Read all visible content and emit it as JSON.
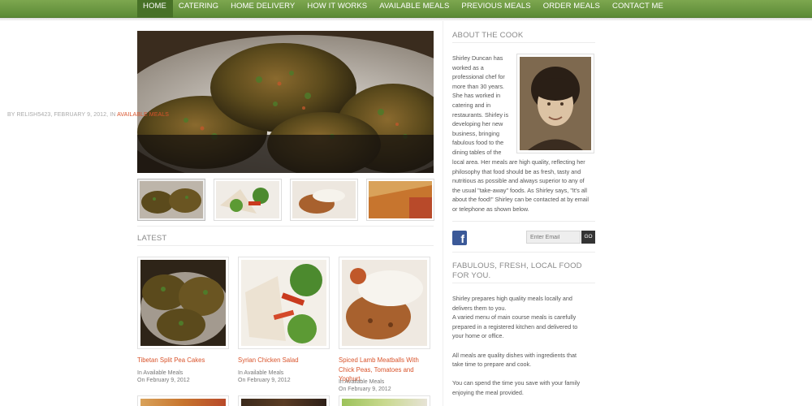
{
  "nav": {
    "items": [
      "HOME",
      "CATERING",
      "HOME DELIVERY",
      "HOW IT WORKS",
      "AVAILABLE MEALS",
      "PREVIOUS MEALS",
      "ORDER MEALS",
      "CONTACT ME"
    ],
    "active": "HOME"
  },
  "hero": {
    "meta_prefix": "BY RELISH5423, FEBRUARY 9, 2012, IN",
    "meta_category": "AVAILABLE MEALS",
    "title": "Tibetan Split Pea Cakes"
  },
  "latest": {
    "heading": "LATEST",
    "cards": [
      {
        "title": "Tibetan Split Pea Cakes",
        "category": "In Available Meals",
        "date": "On February 9, 2012"
      },
      {
        "title": "Syrian Chicken Salad",
        "category": "In Available Meals",
        "date": "On February 9, 2012"
      },
      {
        "title": "Spiced Lamb Meatballs With Chick Peas, Tomatoes and Yoghurt.",
        "category": "In Available Meals",
        "date": "On February 9, 2012"
      }
    ]
  },
  "about": {
    "heading": "ABOUT THE COOK",
    "narrow_lines": [
      "Shirley Duncan has",
      "worked as a",
      "professional chef for",
      "more than 30 years.",
      "She has worked in",
      "catering and in",
      "restaurants. Shirley is",
      "developing her new",
      "business, bringing",
      "fabulous food to the",
      "dining tables of the",
      "local area."
    ],
    "wide_lines": [
      "local area. Her meals are high quality, reflecting her",
      "philosophy that food should be as fresh, tasty and",
      "nutritious as possible and always superior to any of",
      "the usual \"take-away\" foods. As Shirley says, \"It's all",
      "about the food!\" Shirley can be contacted at by email",
      "or telephone as shown below."
    ]
  },
  "subscribe": {
    "placeholder": "Enter Email",
    "button": "GO",
    "social": "f"
  },
  "fabulous": {
    "heading": "FABULOUS, FRESH, LOCAL FOOD FOR YOU.",
    "lines": [
      "Shirley prepares high quality meals locally and",
      "delivers them to you.",
      "A varied menu of main course meals is carefully",
      "prepared in a registered kitchen and delivered to",
      "your home or office.",
      "",
      "All meals are quality dishes with ingredients that",
      "take time to prepare and cook.",
      "",
      "You can spend the time you save with your family",
      "enjoying the meal provided."
    ]
  },
  "colors": {
    "nav_green": "#5b8a36",
    "accent_orange": "#d9542c",
    "facebook": "#3b5998"
  }
}
